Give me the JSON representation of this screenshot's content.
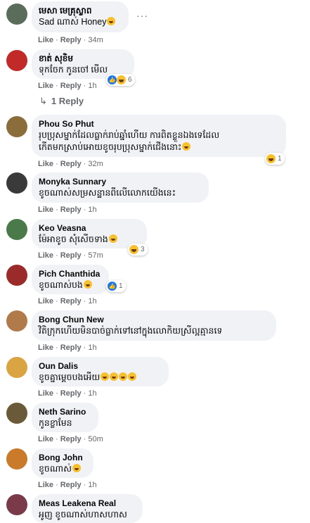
{
  "labels": {
    "like": "Like",
    "reply": "Reply"
  },
  "more_options_icon": "···",
  "reply_toggle": {
    "arrow": "↳",
    "label": "1 Reply"
  },
  "comments": [
    {
      "author": "មេសា មេគ្រុស្លាព",
      "text": "Sad ណាស់ Honey",
      "emoji": "laugh",
      "time": "34m",
      "reactions": null,
      "avatar_color": "#5a6d5a"
    },
    {
      "author": "ខាត់ សុខិម",
      "text": "ទុកចែក កូនចៅ មើល",
      "emoji": null,
      "time": "1h",
      "reactions": {
        "types": [
          "like",
          "haha"
        ],
        "count": "6"
      },
      "avatar_color": "#c22a2a"
    },
    {
      "author": "Phou So Phut",
      "text_lines": [
        "រុបប្រុសម្នាក់ដែលធ្លាក់រាប់ឆ្នាំហើយ ការពិតខ្លួនឯងទេដែល",
        "កើតមកស្រាប់អោយខូចរុបប្រុសម្នាក់ជើងនោះ"
      ],
      "emoji": "laugh",
      "time": "32m",
      "reactions": {
        "types": [
          "haha"
        ],
        "count": "1"
      },
      "avatar_color": "#8a6d3b"
    },
    {
      "author": "Monyka Sunnary",
      "text": "ខូចណាស់សម្រសន្ឋានពីលើលោកយើងនេះ",
      "emoji": null,
      "time": "1h",
      "reactions": null,
      "avatar_color": "#3a3a3a"
    },
    {
      "author": "Keo Veasna",
      "text": "ម៉ែអាខូច សុំសើចទាង",
      "emoji": "laugh-mid",
      "time": "57m",
      "reactions": {
        "types": [
          "haha"
        ],
        "count": "3"
      },
      "avatar_color": "#4a7a4a"
    },
    {
      "author": "Pich Chanthida",
      "text": "ខូចណាស់បង",
      "emoji": "laugh",
      "time": "1h",
      "reactions": {
        "types": [
          "like"
        ],
        "count": "1"
      },
      "avatar_color": "#9b2a2a"
    },
    {
      "author": "Bong Chun New",
      "text": "វិតិក្រុកហើយមិនបាច់ធ្លាក់ទៅនៅក្នុងលោកិយស្រីល្អគ្មានទេ",
      "emoji": null,
      "time": "1h",
      "reactions": null,
      "avatar_color": "#b07a4a"
    },
    {
      "author": "Oun Dalis",
      "text": "ខូចគ្នាម្តេចបងអើយ",
      "emoji": "rofl4",
      "time": "1h",
      "reactions": null,
      "avatar_color": "#d9a441"
    },
    {
      "author": "Neth Sarino",
      "text": "កូនខ្លាមែន",
      "emoji": null,
      "time": "50m",
      "reactions": null,
      "avatar_color": "#6b5a3a"
    },
    {
      "author": "Bong John",
      "text": "ខូចណាស់",
      "emoji": "laugh",
      "time": "1h",
      "reactions": null,
      "avatar_color": "#c97a2a"
    },
    {
      "author": "Meas Leakena Real",
      "text": "អូញ ខូចណាស់ហាសហាស",
      "emoji": null,
      "time": null,
      "reactions": null,
      "avatar_color": "#7a3a4a"
    }
  ]
}
